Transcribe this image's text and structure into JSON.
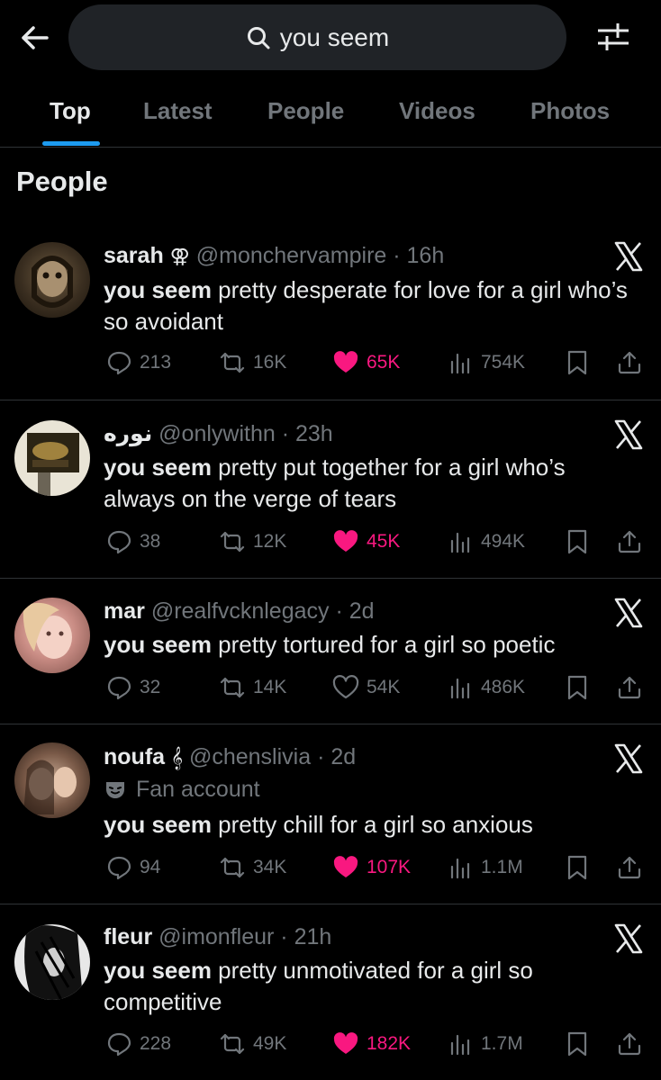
{
  "search": {
    "query": "you seem"
  },
  "tabs": [
    "Top",
    "Latest",
    "People",
    "Videos",
    "Photos"
  ],
  "section_title": "People",
  "colors": {
    "accent": "#1d9bf0",
    "like": "#f91880",
    "muted": "#71767b"
  },
  "tweets": [
    {
      "name": "sarah",
      "badge": "⚢",
      "handle": "@monchervampire",
      "time": "16h",
      "text_bold": "you seem",
      "text_rest": " pretty desperate for love for a girl who’s so avoidant",
      "replies": "213",
      "reposts": "16K",
      "likes": "65K",
      "views": "754K",
      "liked": true
    },
    {
      "name": "نوره",
      "badge": "",
      "handle": "@onlywithn",
      "time": "23h",
      "text_bold": "you seem",
      "text_rest": " pretty put together for a girl who’s always on the verge of tears",
      "replies": "38",
      "reposts": "12K",
      "likes": "45K",
      "views": "494K",
      "liked": true
    },
    {
      "name": "mar",
      "badge": "",
      "handle": "@realfvcknlegacy",
      "time": "2d",
      "text_bold": "you seem",
      "text_rest": " pretty tortured for a girl so poetic",
      "replies": "32",
      "reposts": "14K",
      "likes": "54K",
      "views": "486K",
      "liked": false
    },
    {
      "name": "noufa",
      "badge": "𝄞",
      "handle": "@chenslivia",
      "time": "2d",
      "fan_label": "Fan account",
      "text_bold": "you seem",
      "text_rest": " pretty chill for a girl so anxious",
      "replies": "94",
      "reposts": "34K",
      "likes": "107K",
      "views": "1.1M",
      "liked": true
    },
    {
      "name": "fleur",
      "badge": "",
      "handle": "@imonfleur",
      "time": "21h",
      "text_bold": "you seem",
      "text_rest": " pretty unmotivated for a girl so competitive",
      "replies": "228",
      "reposts": "49K",
      "likes": "182K",
      "views": "1.7M",
      "liked": true
    }
  ]
}
